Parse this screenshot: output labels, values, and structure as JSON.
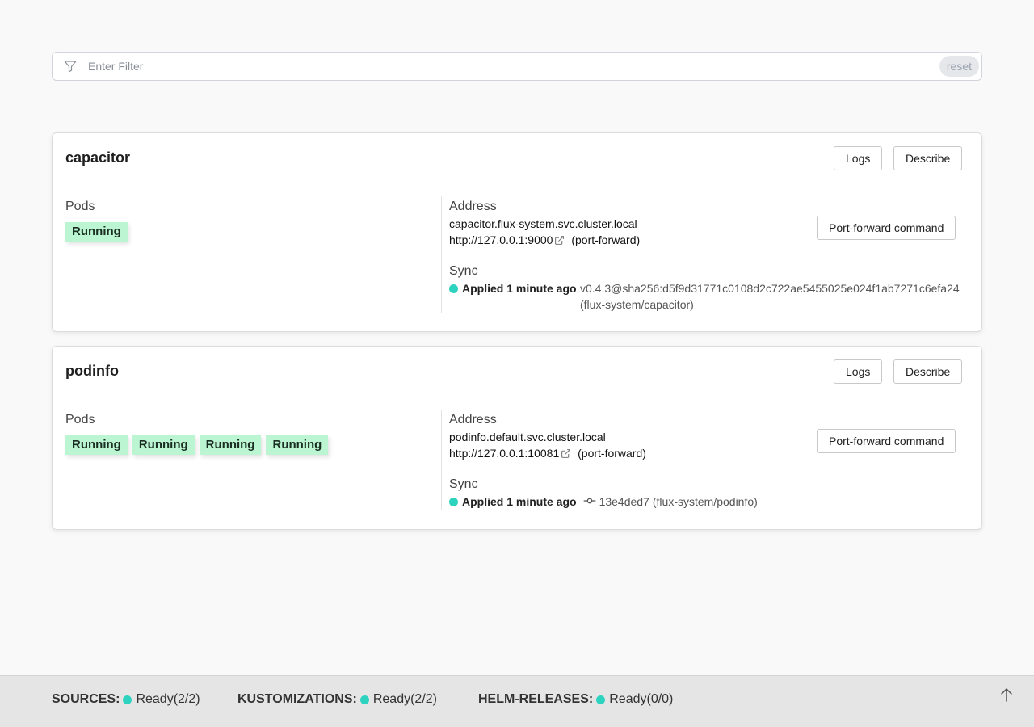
{
  "filter": {
    "placeholder": "Enter Filter",
    "reset_label": "reset"
  },
  "buttons": {
    "logs": "Logs",
    "describe": "Describe",
    "port_forward": "Port-forward command"
  },
  "labels": {
    "pods": "Pods",
    "address": "Address",
    "sync": "Sync"
  },
  "services": [
    {
      "name": "capacitor",
      "pods": [
        "Running"
      ],
      "address": "capacitor.flux-system.svc.cluster.local",
      "local_url": "http://127.0.0.1:9000",
      "port_forward_note": "(port-forward)",
      "sync_status": "Applied 1 minute ago",
      "revision": "v0.4.3@sha256:d5f9d31771c0108d2c722ae5455025e024f1ab7271c6efa24",
      "source": "(flux-system/capacitor)"
    },
    {
      "name": "podinfo",
      "pods": [
        "Running",
        "Running",
        "Running",
        "Running"
      ],
      "address": "podinfo.default.svc.cluster.local",
      "local_url": "http://127.0.0.1:10081",
      "port_forward_note": "(port-forward)",
      "sync_status": "Applied 1 minute ago",
      "revision": "13e4ded7",
      "source": "(flux-system/podinfo)"
    }
  ],
  "footer": {
    "sources_label": "SOURCES:",
    "sources_value": "Ready(2/2)",
    "kustomizations_label": "KUSTOMIZATIONS:",
    "kustomizations_value": "Ready(2/2)",
    "helm_label": "HELM-RELEASES:",
    "helm_value": "Ready(0/0)"
  },
  "colors": {
    "status_ready": "#2ed3c0",
    "pod_running_bg": "#bbf5d2"
  }
}
